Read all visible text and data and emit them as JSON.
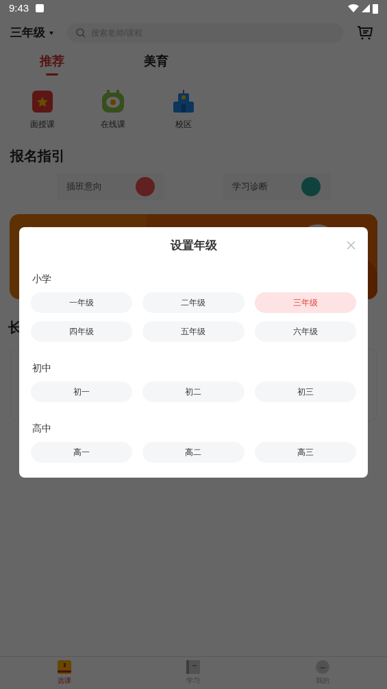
{
  "status_bar": {
    "time": "9:43"
  },
  "header": {
    "grade": "三年级",
    "search": {
      "placeholder": "搜索老师/课程"
    }
  },
  "tabs": [
    {
      "label": "推荐",
      "selected": true
    },
    {
      "label": "美育",
      "selected": false
    }
  ],
  "categories": [
    {
      "label": "面授课"
    },
    {
      "label": "在线课"
    },
    {
      "label": "校区"
    }
  ],
  "guide": {
    "title": "报名指引",
    "cards": [
      {
        "label": "插班意向"
      },
      {
        "label": "学习诊断"
      }
    ]
  },
  "section_heading": "长",
  "modal": {
    "title": "设置年级",
    "groups": [
      {
        "label": "小学",
        "options": [
          {
            "label": "一年级",
            "selected": false
          },
          {
            "label": "二年级",
            "selected": false
          },
          {
            "label": "三年级",
            "selected": true
          },
          {
            "label": "四年级",
            "selected": false
          },
          {
            "label": "五年级",
            "selected": false
          },
          {
            "label": "六年级",
            "selected": false
          }
        ]
      },
      {
        "label": "初中",
        "options": [
          {
            "label": "初一",
            "selected": false
          },
          {
            "label": "初二",
            "selected": false
          },
          {
            "label": "初三",
            "selected": false
          }
        ]
      },
      {
        "label": "高中",
        "options": [
          {
            "label": "高一",
            "selected": false
          },
          {
            "label": "高二",
            "selected": false
          },
          {
            "label": "高三",
            "selected": false
          }
        ]
      }
    ]
  },
  "bottom_nav": [
    {
      "label": "选课",
      "selected": true
    },
    {
      "label": "学习",
      "selected": false
    },
    {
      "label": "我的",
      "selected": false
    }
  ]
}
